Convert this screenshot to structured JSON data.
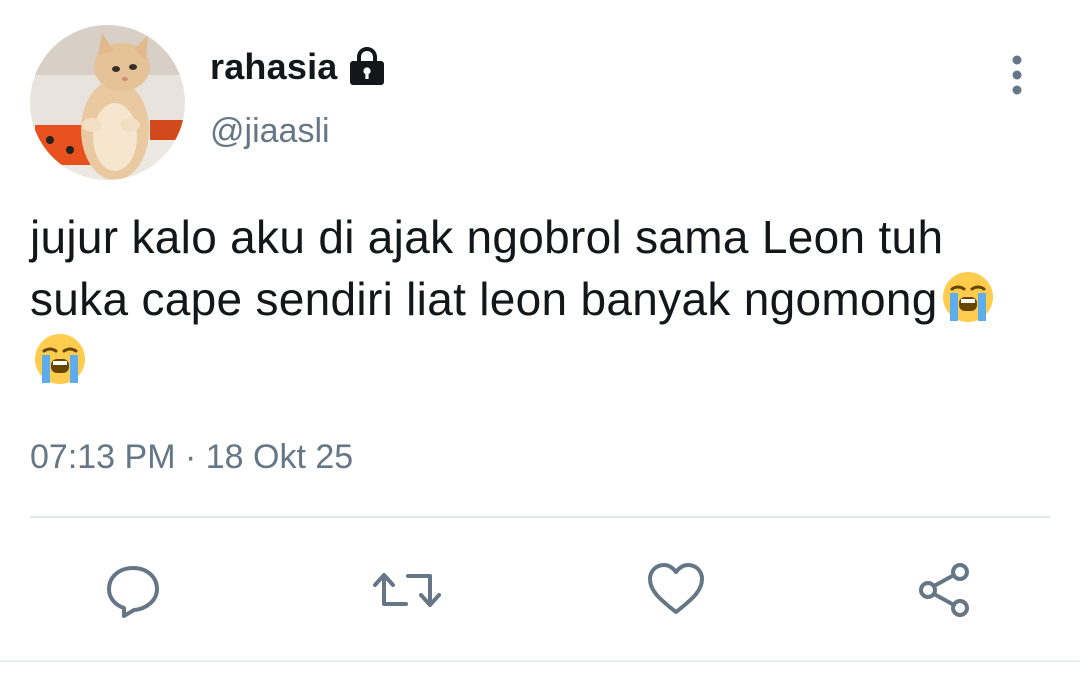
{
  "user": {
    "display_name": "rahasia",
    "handle": "@jiaasli",
    "avatar_icon": "kitten-avatar",
    "protected_icon": "lock-icon"
  },
  "tweet": {
    "text": "jujur kalo aku di ajak ngobrol sama Leon tuh suka cape sendiri liat leon banyak ngomong",
    "emojis": [
      "loudly-crying-face",
      "loudly-crying-face"
    ],
    "time": "07:13 PM",
    "separator": "·",
    "date": "18 Okt 25"
  },
  "actions": [
    {
      "name": "reply",
      "icon": "speech-bubble-icon"
    },
    {
      "name": "retweet",
      "icon": "retweet-icon"
    },
    {
      "name": "like",
      "icon": "heart-icon"
    },
    {
      "name": "share",
      "icon": "share-icon"
    }
  ],
  "colors": {
    "text_primary": "#14171a",
    "text_secondary": "#657786",
    "icon": "#657786",
    "divider": "#e1e8ed"
  }
}
